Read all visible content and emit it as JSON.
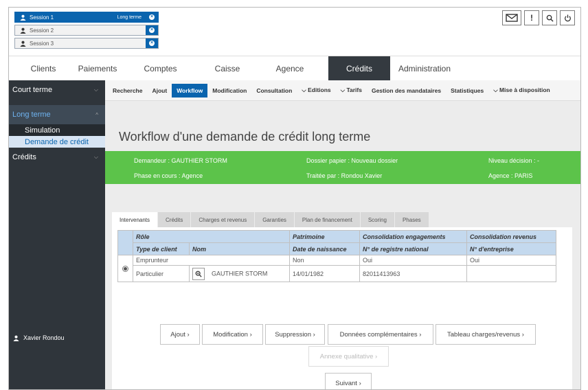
{
  "sessions": [
    {
      "label": "Session 1",
      "term": "Long terme",
      "active": true
    },
    {
      "label": "Session 2"
    },
    {
      "label": "Session 3"
    }
  ],
  "mainnav": [
    "Clients",
    "Paiements",
    "Comptes",
    "Caisse",
    "Agence",
    "Crédits",
    "Administration"
  ],
  "sidebar": {
    "court_terme": "Court terme",
    "long_terme": "Long terme",
    "simulation": "Simulation",
    "demande": "Demande de crédit",
    "credits": "Crédits",
    "user": "Xavier Rondou"
  },
  "subnav": [
    "Recherche",
    "Ajout",
    "Workflow",
    "Modification",
    "Consultation",
    "⌵ Editions",
    "⌵ Tarifs",
    "Gestion des mandataires",
    "Statistiques",
    "⌵ Mise à disposition"
  ],
  "page_title": "Workflow d'une demande de crédit long terme",
  "banner": {
    "demandeur": "Demandeur : GAUTHIER STORM",
    "dossier": "Dossier papier : Nouveau dossier",
    "niveau": "Niveau décision : -",
    "phase": "Phase en cours : Agence",
    "traitee": "Traitée par : Rondou Xavier",
    "agence": "Agence : PARIS"
  },
  "tabs": [
    "Intervenants",
    "Crédits",
    "Charges et revenus",
    "Garanties",
    "Plan de financement",
    "Scoring",
    "Phases"
  ],
  "table": {
    "h1": [
      "Rôle",
      "Patrimoine",
      "Consolidation engagements",
      "Consolidation revenus"
    ],
    "h2": [
      "Type de client",
      "Nom",
      "Date de naissance",
      "N° de registre national",
      "N° d'entreprise"
    ],
    "r1": [
      "Emprunteur",
      "Non",
      "Oui",
      "Oui"
    ],
    "r2": [
      "Particulier",
      "GAUTHIER STORM",
      "14/01/1982",
      "82011413963",
      ""
    ]
  },
  "buttons": {
    "ajout": "Ajout ›",
    "modification": "Modification ›",
    "suppression": "Suppression ›",
    "donnees": "Données complémentaires ›",
    "tableau": "Tableau charges/revenus ›",
    "annexe": "Annexe qualitative ›",
    "suivant": "Suivant ›"
  }
}
